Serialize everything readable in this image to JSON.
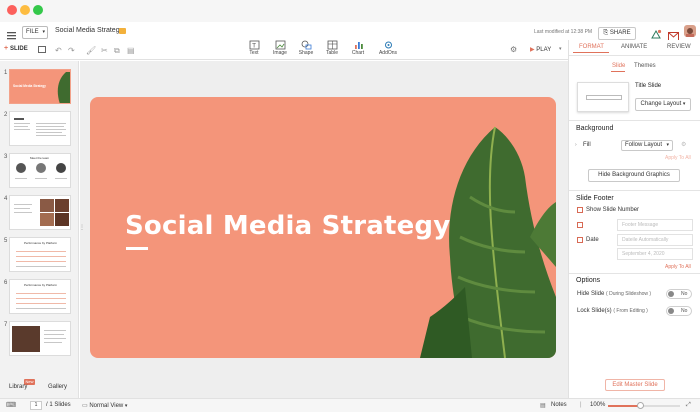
{
  "window": {
    "dots": [
      "#fc605c",
      "#fdbc40",
      "#34c84a"
    ]
  },
  "menubar": {
    "file_label": "FILE",
    "doc_title": "Social Media Strategy",
    "last_modified": "Last modified at 12:38 PM",
    "share_label": "SHARE"
  },
  "toolbar": {
    "slide_label": "SLIDE",
    "tools": [
      "Text",
      "Image",
      "Shape",
      "Table",
      "Chart",
      "AddOns"
    ],
    "play_label": "PLAY"
  },
  "right_tabs": [
    "FORMAT",
    "ANIMATE",
    "REVIEW"
  ],
  "format": {
    "subtabs": [
      "Slide",
      "Themes"
    ],
    "layout_name": "Title Slide",
    "change_layout": "Change Layout",
    "background": {
      "heading": "Background",
      "fill_label": "Fill",
      "fill_value": "Follow Layout",
      "apply_all": "Apply To All",
      "hide_graphics": "Hide Background Graphics"
    },
    "footer": {
      "heading": "Slide Footer",
      "show_number": "Show Slide Number",
      "footer_placeholder": "Footer Message",
      "date_label": "Date",
      "date_placeholder": "Dateile Automatically",
      "date_value": "September 4, 2020",
      "apply_all": "Apply To All"
    },
    "options": {
      "heading": "Options",
      "hide_slide": "Hide Slide",
      "hide_slide_note": "( During Slideshow )",
      "lock_slide": "Lock Slide(s)",
      "lock_slide_note": "( From Editing )",
      "toggle_text": "No"
    },
    "edit_master": "Edit Master Slide"
  },
  "thumbnails": [
    {
      "num": "1",
      "title": "Social Media Strategy"
    },
    {
      "num": "2",
      "title": ""
    },
    {
      "num": "3",
      "title": "Meet the team"
    },
    {
      "num": "4",
      "title": ""
    },
    {
      "num": "5",
      "title": "Performance by Platform"
    },
    {
      "num": "6",
      "title": "Performance by Platform"
    },
    {
      "num": "7",
      "title": ""
    }
  ],
  "left_bottom": {
    "library": "Library",
    "gallery": "Gallery",
    "badge": "New"
  },
  "slide": {
    "title": "Social Media Strategy"
  },
  "status": {
    "page_current": "1",
    "page_total": "/ 1 Slides",
    "view_mode": "Normal View",
    "notes": "Notes",
    "zoom": "100%"
  },
  "colors": {
    "accent": "#e0725b",
    "slide_bg": "#f4957a",
    "leaf": "#3f6b2f"
  }
}
